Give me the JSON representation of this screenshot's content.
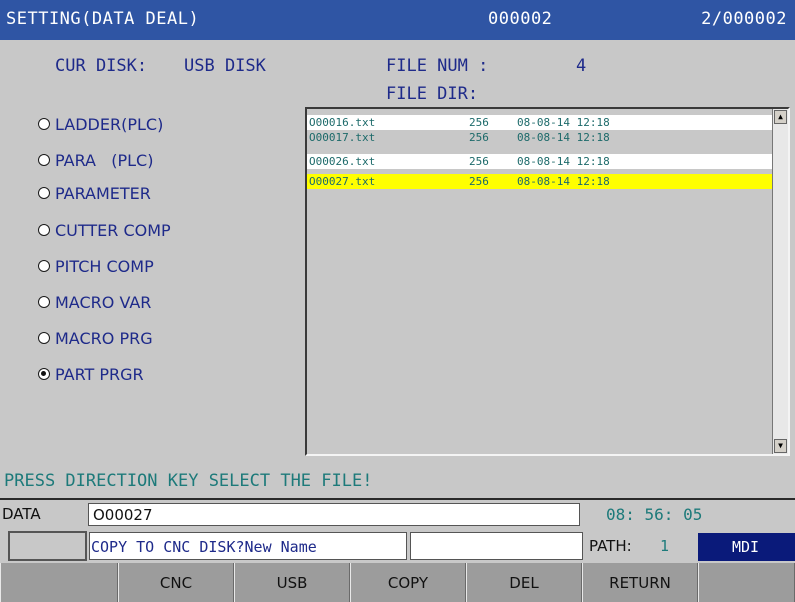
{
  "title": {
    "left": "SETTING(DATA DEAL)",
    "center": "000002",
    "right": "2/000002"
  },
  "info": {
    "cur_disk_label": "CUR DISK:",
    "cur_disk_value": "USB DISK",
    "file_num_label": "FILE NUM :",
    "file_num_value": "4",
    "file_dir_label": "FILE DIR:"
  },
  "options": [
    {
      "label": "LADDER(PLC)",
      "selected": false
    },
    {
      "label": "PARA   (PLC)",
      "selected": false
    },
    {
      "label": "PARAMETER",
      "selected": false
    },
    {
      "label": "CUTTER COMP",
      "selected": false
    },
    {
      "label": "PITCH COMP",
      "selected": false
    },
    {
      "label": "MACRO VAR",
      "selected": false
    },
    {
      "label": "MACRO PRG",
      "selected": false
    },
    {
      "label": "PART PRGR",
      "selected": true
    }
  ],
  "files": [
    {
      "name": "O00016.txt",
      "size": "256",
      "date": "08-08-14 12:18",
      "bg": "#ffffff"
    },
    {
      "name": "O00017.txt",
      "size": "256",
      "date": "08-08-14 12:18",
      "bg": "#c8c8c8"
    },
    {
      "name": "O00026.txt",
      "size": "256",
      "date": "08-08-14 12:18",
      "bg": "#ffffff"
    },
    {
      "name": "O00027.txt",
      "size": "256",
      "date": "08-08-14 12:18",
      "bg": "#ffff00"
    }
  ],
  "prompt": "PRESS DIRECTION KEY SELECT THE FILE!",
  "data": {
    "label": "DATA",
    "value": "O00027",
    "time": "08: 56: 05"
  },
  "status": {
    "message": "COPY TO CNC DISK?New Name",
    "path_label": "PATH:",
    "path_value": "1",
    "mode": "MDI"
  },
  "softkeys": [
    "",
    "CNC",
    "USB",
    "COPY",
    "DEL",
    "RETURN",
    ""
  ],
  "colors": {
    "title_bar": "#2f55a4",
    "selected_row": "#ffff00",
    "mode_badge": "#0a1a7a"
  }
}
